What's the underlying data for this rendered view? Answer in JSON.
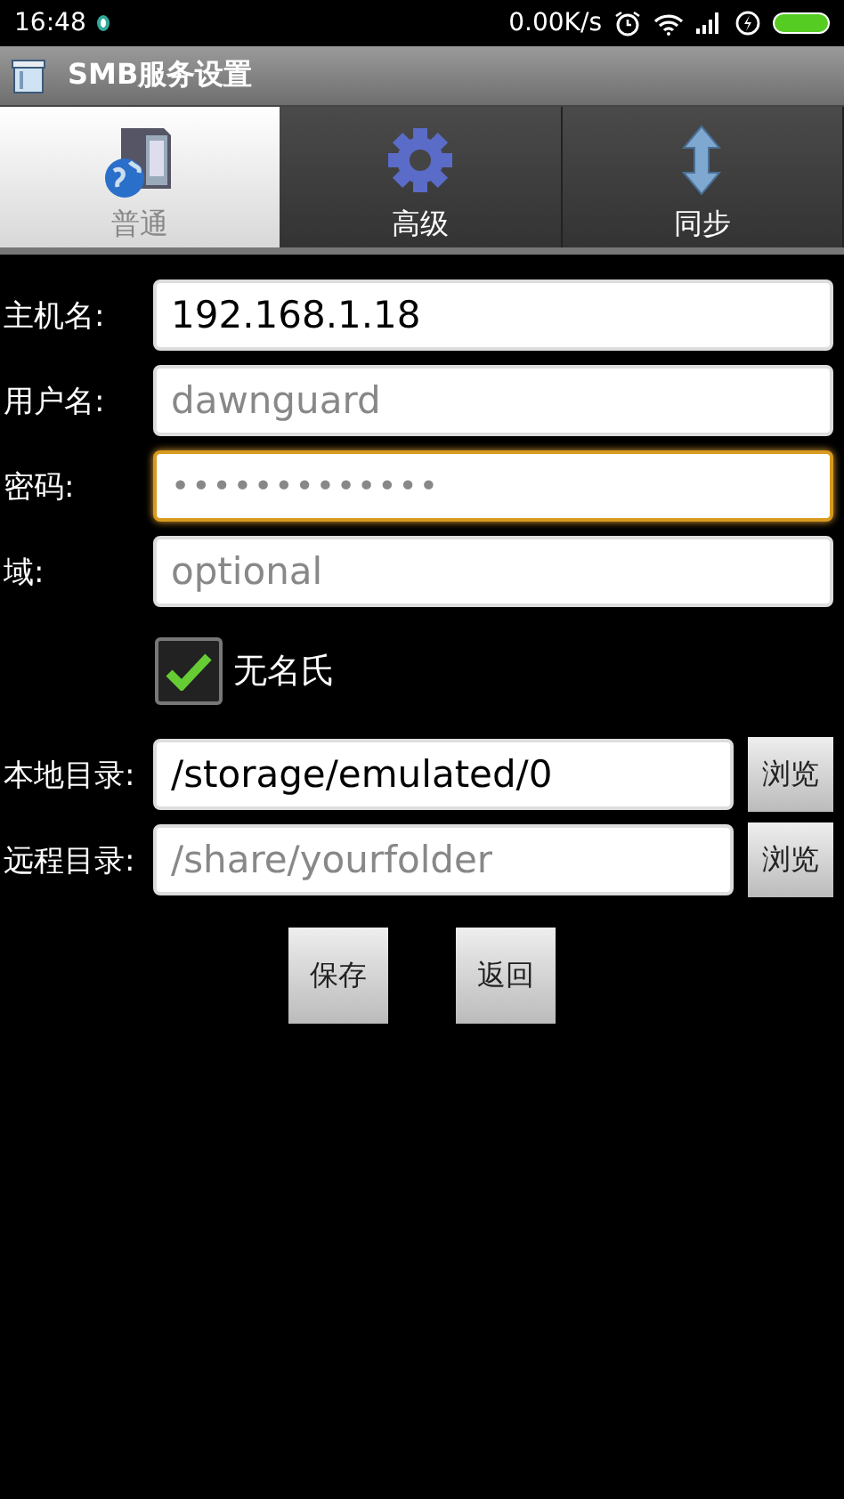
{
  "status_bar": {
    "time": "16:48",
    "speed": "0.00K/s"
  },
  "title_bar": {
    "title": "SMB服务设置"
  },
  "tabs": [
    {
      "label": "普通",
      "selected": true
    },
    {
      "label": "高级",
      "selected": false
    },
    {
      "label": "同步",
      "selected": false
    }
  ],
  "form": {
    "fields": [
      {
        "label": "主机名:",
        "kind": "text",
        "value": "192.168.1.18",
        "focused": false
      },
      {
        "label": "用户名:",
        "kind": "text",
        "placeholder": "dawnguard",
        "focused": false
      },
      {
        "label": "密码:",
        "kind": "password",
        "value": "•••••••••••••",
        "focused": true
      },
      {
        "label": "域:",
        "kind": "text",
        "placeholder": "optional",
        "focused": false
      }
    ],
    "anonymous": {
      "label": "无名氏",
      "checked": true
    },
    "folders": [
      {
        "label": "本地目录:",
        "value": "/storage/emulated/0",
        "browse": "浏览"
      },
      {
        "label": "远程目录:",
        "placeholder": "/share/yourfolder",
        "browse": "浏览"
      }
    ],
    "buttons": [
      "保存",
      "返回"
    ]
  }
}
